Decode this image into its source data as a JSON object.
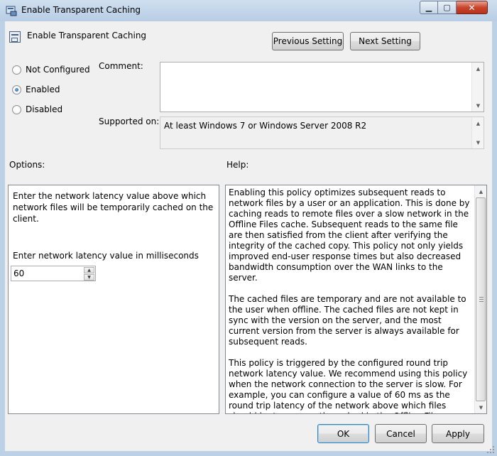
{
  "window": {
    "title": "Enable Transparent Caching",
    "min_glyph": "▁",
    "max_glyph": "▢",
    "close_glyph": "✕"
  },
  "header": {
    "title": "Enable Transparent Caching"
  },
  "nav": {
    "previous_label": "Previous Setting",
    "next_label": "Next Setting"
  },
  "state": {
    "options": [
      {
        "label": "Not Configured",
        "checked": false
      },
      {
        "label": "Enabled",
        "checked": true
      },
      {
        "label": "Disabled",
        "checked": false
      }
    ]
  },
  "comment": {
    "label": "Comment:",
    "value": ""
  },
  "supported": {
    "label": "Supported on:",
    "value": "At least Windows 7 or Windows Server 2008 R2"
  },
  "options_panel": {
    "heading": "Options:",
    "description": "Enter the network latency value above which network files will be temporarily cached on the client.",
    "latency_label": "Enter network latency value in milliseconds",
    "latency_value": "60"
  },
  "help_panel": {
    "heading": "Help:",
    "text": "Enabling this policy optimizes subsequent reads to network files by a user or an application. This is done by caching reads to remote files over a slow network in the Offline Files cache. Subsequent reads to the same file are then satisfied from the client after verifying the integrity of the cached copy. This policy not only yields improved end-user response times but also decreased bandwidth consumption over the WAN links to the server.\n\nThe cached files are temporary and are not available to the user when offline. The cached files are not kept in sync with the version on the server, and the most current version from the server is always available for subsequent reads.\n\nThis policy is triggered by the configured round trip network latency value. We recommend using this policy when the network connection to the server is slow. For example, you can configure a value of 60 ms as the round trip latency of the network above which files should be transparently cached in the Offline Files cache. If the round trip latency of the network is less than 60ms, reads to remote files will not be cached."
  },
  "footer": {
    "ok_label": "OK",
    "cancel_label": "Cancel",
    "apply_label": "Apply"
  },
  "colors": {
    "accent": "#3c7fb1",
    "close_button": "#c9452d",
    "titlebar": "#bcd0e6"
  }
}
